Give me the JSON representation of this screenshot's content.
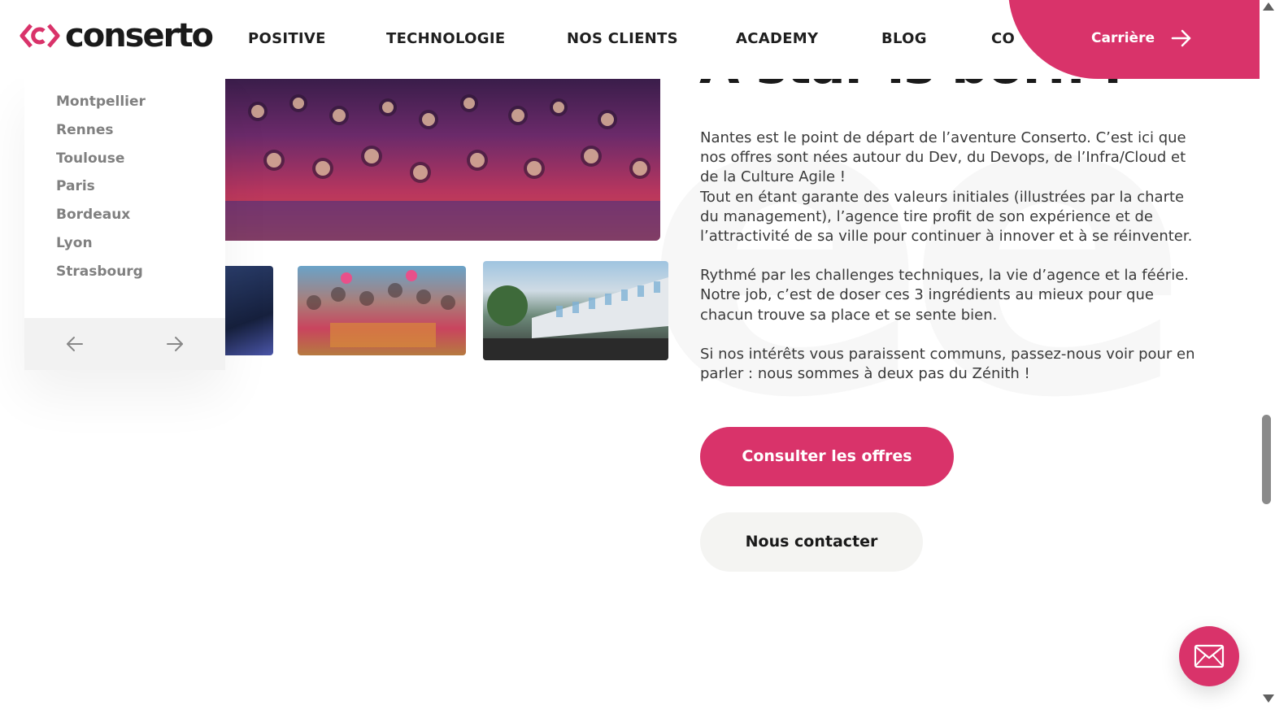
{
  "brand": {
    "logo_text": "conserto",
    "accent_color": "#d9336a"
  },
  "nav": {
    "items": [
      {
        "label": "POSITIVE"
      },
      {
        "label": "TECHNOLOGIE"
      },
      {
        "label": "NOS CLIENTS"
      },
      {
        "label": "ACADEMY"
      },
      {
        "label": "BLOG"
      },
      {
        "label": "CO"
      }
    ],
    "career_label": "Carrière"
  },
  "cities": {
    "items": [
      {
        "label": "Montpellier"
      },
      {
        "label": "Rennes"
      },
      {
        "label": "Toulouse"
      },
      {
        "label": "Paris"
      },
      {
        "label": "Bordeaux"
      },
      {
        "label": "Lyon"
      },
      {
        "label": "Strasbourg"
      }
    ]
  },
  "content": {
    "heading_partial": "A star is born !",
    "paragraphs": [
      "Nantes est le point de départ de l’aventure Conserto. C’est ici que nos offres sont nées autour du Dev, du Devops, de l’Infra/Cloud et de la Culture Agile !",
      "Tout en étant garante des valeurs initiales (illustrées par la charte du management), l’agence tire profit de son expérience et de l’attractivité de sa ville pour continuer à innover et à se réinventer.",
      "Rythmé par les challenges techniques, la vie d’agence et la féérie. Notre job, c’est de doser ces 3 ingrédients au mieux pour que chacun trouve sa place et se sente bien.",
      "Si nos intérêts vous paraissent communs, passez-nous voir pour en parler : nous sommes à deux pas du Zénith !"
    ],
    "primary_button": "Consulter les offres",
    "secondary_button": "Nous contacter"
  },
  "icons": {
    "career_arrow": "arrow-right-icon",
    "prev": "arrow-left-icon",
    "next": "arrow-right-icon",
    "fab": "mail-icon"
  }
}
